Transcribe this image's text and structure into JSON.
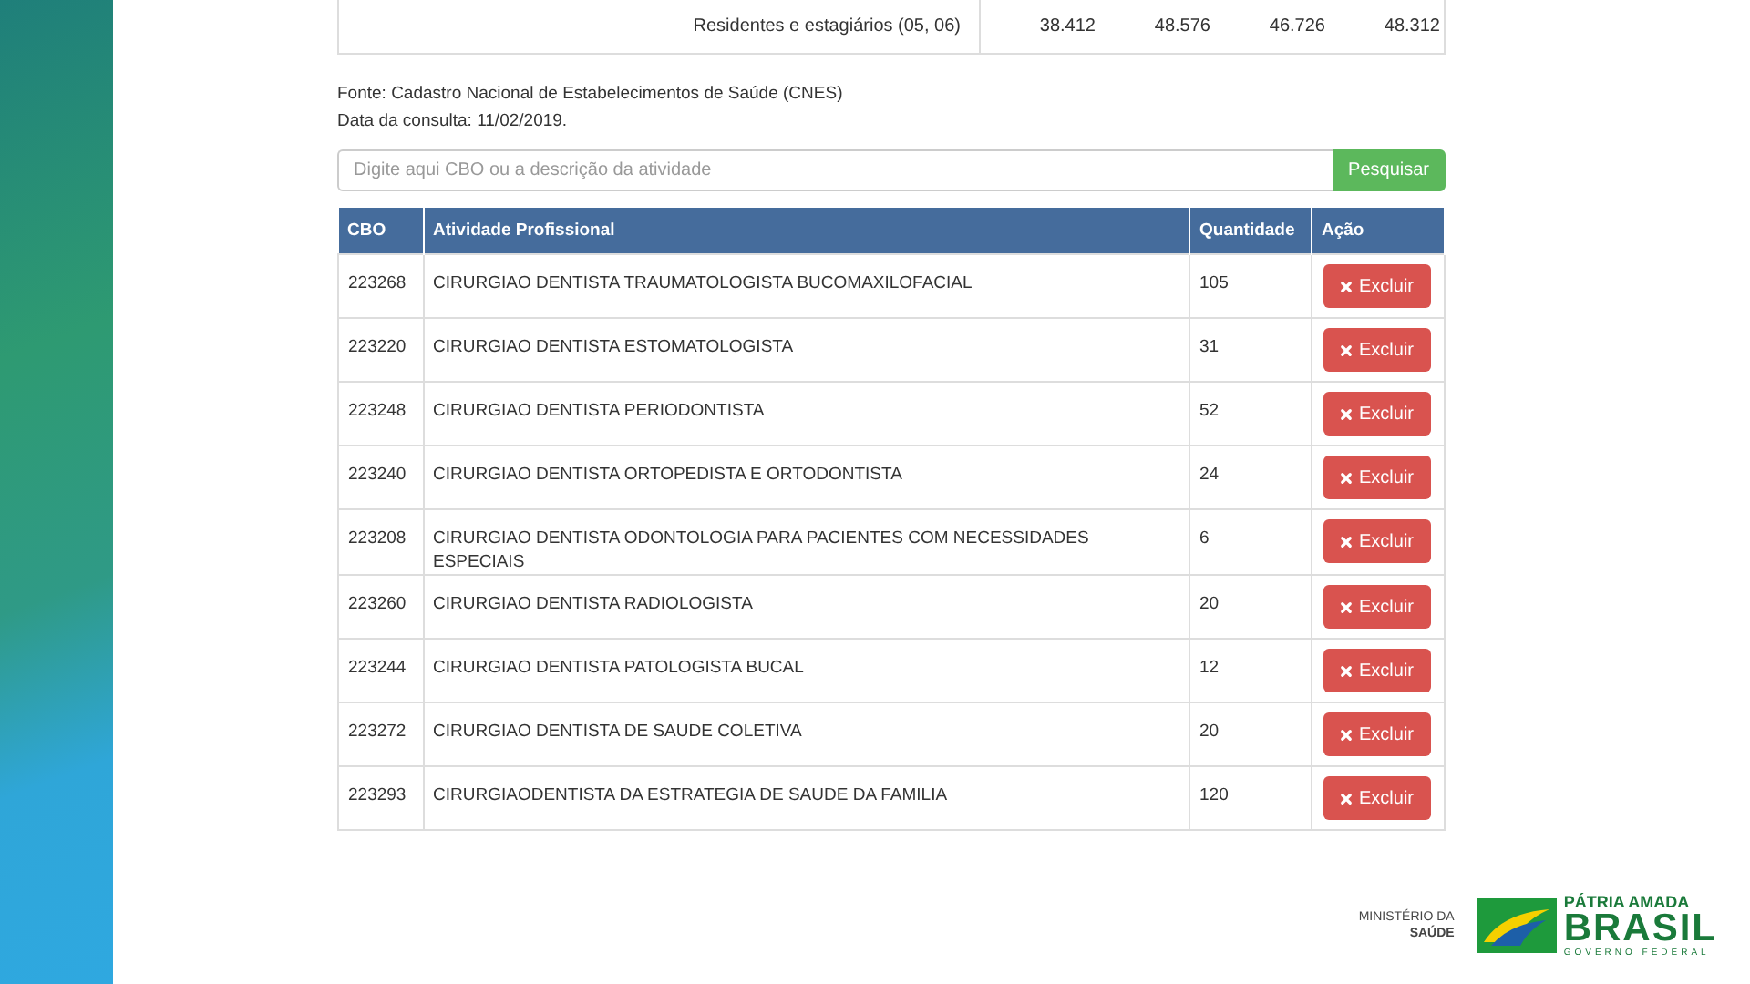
{
  "summary_row": {
    "label": "Residentes e estagiários (05, 06)",
    "values": [
      "38.412",
      "48.576",
      "46.726",
      "48.312"
    ]
  },
  "source_lines": [
    "Fonte: Cadastro Nacional de Estabelecimentos de Saúde (CNES)",
    "Data da consulta: 11/02/2019."
  ],
  "search": {
    "placeholder": "Digite aqui CBO ou a descrição da atividade",
    "button": "Pesquisar"
  },
  "table": {
    "columns": [
      "CBO",
      "Atividade Profissional",
      "Quantidade",
      "Ação"
    ],
    "rows": [
      {
        "cbo": "223268",
        "activity": "CIRURGIAO DENTISTA TRAUMATOLOGISTA BUCOMAXILOFACIAL",
        "quantity": "105",
        "action": "Excluir"
      },
      {
        "cbo": "223220",
        "activity": "CIRURGIAO DENTISTA ESTOMATOLOGISTA",
        "quantity": "31",
        "action": "Excluir"
      },
      {
        "cbo": "223248",
        "activity": "CIRURGIAO DENTISTA PERIODONTISTA",
        "quantity": "52",
        "action": "Excluir"
      },
      {
        "cbo": "223240",
        "activity": "CIRURGIAO DENTISTA ORTOPEDISTA E ORTODONTISTA",
        "quantity": "24",
        "action": "Excluir"
      },
      {
        "cbo": "223208",
        "activity": "CIRURGIAO DENTISTA ODONTOLOGIA PARA PACIENTES COM NECESSIDADES ESPECIAIS",
        "quantity": "6",
        "action": "Excluir"
      },
      {
        "cbo": "223260",
        "activity": "CIRURGIAO DENTISTA RADIOLOGISTA",
        "quantity": "20",
        "action": "Excluir"
      },
      {
        "cbo": "223244",
        "activity": "CIRURGIAO DENTISTA PATOLOGISTA BUCAL",
        "quantity": "12",
        "action": "Excluir"
      },
      {
        "cbo": "223272",
        "activity": "CIRURGIAO DENTISTA DE SAUDE COLETIVA",
        "quantity": "20",
        "action": "Excluir"
      },
      {
        "cbo": "223293",
        "activity": "CIRURGIAODENTISTA DA ESTRATEGIA DE SAUDE DA FAMILIA",
        "quantity": "120",
        "action": "Excluir"
      }
    ]
  },
  "footer": {
    "ministry": [
      "MINISTÉRIO DA",
      "SAÚDE"
    ],
    "slogan": "PÁTRIA AMADA",
    "country": "BRASIL",
    "government": "GOVERNO FEDERAL"
  }
}
